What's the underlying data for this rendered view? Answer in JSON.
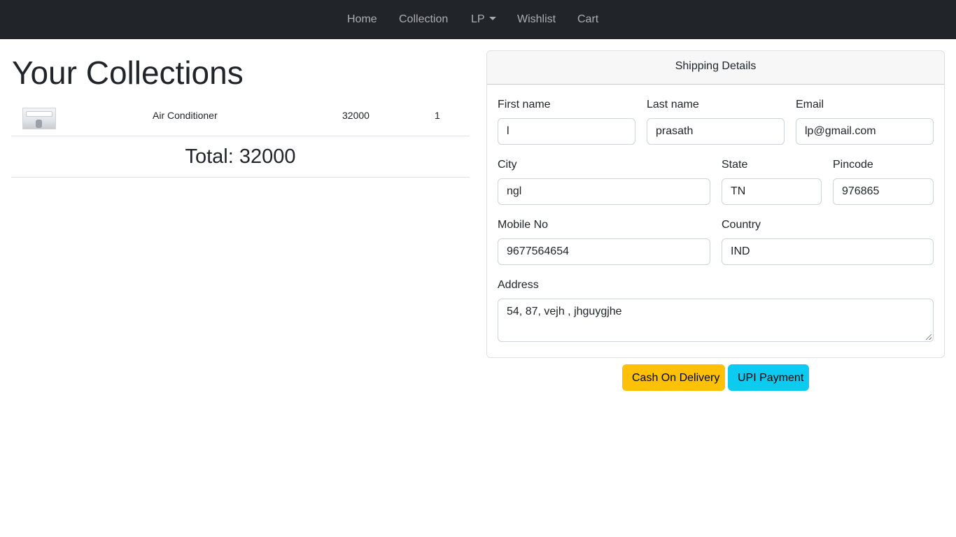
{
  "nav": {
    "home": "Home",
    "collection": "Collection",
    "user": "LP",
    "wishlist": "Wishlist",
    "cart": "Cart"
  },
  "collections": {
    "title": "Your Collections",
    "items": [
      {
        "name": "Air Conditioner",
        "price": "32000",
        "quantity": "1",
        "thumb_icon": "air-conditioner-image"
      }
    ],
    "total": "Total: 32000"
  },
  "shipping": {
    "header": "Shipping Details",
    "first_name": {
      "label": "First name",
      "value": "l"
    },
    "last_name": {
      "label": "Last name",
      "value": "prasath"
    },
    "email": {
      "label": "Email",
      "value": "lp@gmail.com"
    },
    "city": {
      "label": "City",
      "value": "ngl"
    },
    "state": {
      "label": "State",
      "value": "TN"
    },
    "pincode": {
      "label": "Pincode",
      "value": "976865"
    },
    "mobile": {
      "label": "Mobile No",
      "value": "9677564654"
    },
    "country": {
      "label": "Country",
      "value": "IND"
    },
    "address": {
      "label": "Address",
      "value": "54, 87, vejh , jhguygjhe"
    }
  },
  "buttons": {
    "cod": "Cash On Delivery",
    "upi": "UPI Payment"
  },
  "colors": {
    "navbar": "#212529",
    "cod_button": "#ffc107",
    "upi_button": "#0dcaf0"
  }
}
